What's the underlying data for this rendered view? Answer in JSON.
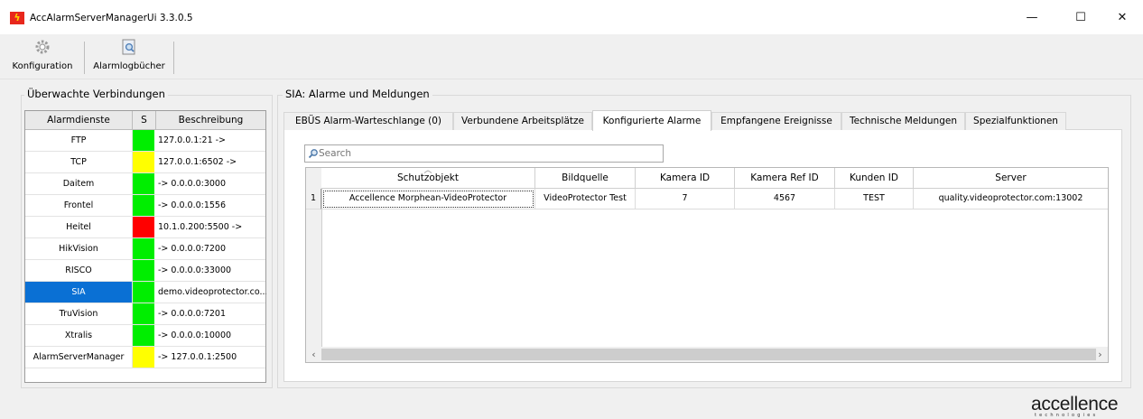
{
  "window": {
    "title": "AccAlarmServerManagerUi 3.3.0.5",
    "app_icon": "app-flash-icon",
    "controls": [
      "minimize-icon",
      "maximize-icon",
      "close-icon"
    ]
  },
  "toolbar": {
    "items": [
      {
        "label": "Konfiguration",
        "icon": "gear-icon"
      },
      {
        "label": "Alarmlogbücher",
        "icon": "logbook-search-icon"
      }
    ]
  },
  "left_panel": {
    "title": "Überwachte Verbindungen",
    "columns": [
      "Alarmdienste",
      "S",
      "Beschreibung"
    ],
    "rows": [
      {
        "name": "FTP",
        "status": "green",
        "description": "127.0.0.1:21 ->"
      },
      {
        "name": "TCP",
        "status": "yellow",
        "description": "127.0.0.1:6502 ->"
      },
      {
        "name": "Daitem",
        "status": "green",
        "description": "-> 0.0.0.0:3000"
      },
      {
        "name": "Frontel",
        "status": "green",
        "description": "-> 0.0.0.0:1556"
      },
      {
        "name": "Heitel",
        "status": "red",
        "description": "10.1.0.200:5500 ->"
      },
      {
        "name": "HikVision",
        "status": "green",
        "description": "-> 0.0.0.0:7200"
      },
      {
        "name": "RISCO",
        "status": "green",
        "description": "-> 0.0.0.0:33000"
      },
      {
        "name": "SIA",
        "status": "green",
        "description": "demo.videoprotector.co...",
        "selected": true
      },
      {
        "name": "TruVision",
        "status": "green",
        "description": "-> 0.0.0.0:7201"
      },
      {
        "name": "Xtralis",
        "status": "green",
        "description": "-> 0.0.0.0:10000"
      },
      {
        "name": "AlarmServerManager",
        "status": "yellow",
        "description": "-> 127.0.0.1:2500"
      }
    ]
  },
  "right_panel": {
    "title": "SIA: Alarme und Meldungen",
    "tabs": [
      {
        "label": "EBÜS Alarm-Warteschlange (0)"
      },
      {
        "label": "Verbundene Arbeitsplätze"
      },
      {
        "label": "Konfigurierte Alarme",
        "active": true
      },
      {
        "label": "Empfangene Ereignisse"
      },
      {
        "label": "Technische Meldungen"
      },
      {
        "label": "Spezialfunktionen"
      }
    ],
    "search": {
      "placeholder": "Search",
      "value": ""
    },
    "grid": {
      "columns": [
        "Schutzobjekt",
        "Bildquelle",
        "Kamera ID",
        "Kamera Ref ID",
        "Kunden ID",
        "Server"
      ],
      "sort_column": "Schutzobjekt",
      "rows": [
        {
          "index": "1",
          "cells": [
            "Accellence Morphean-VideoProtector",
            "VideoProtector Test",
            "7",
            "4567",
            "TEST",
            "quality.videoprotector.com:13002"
          ]
        }
      ]
    }
  },
  "colors": {
    "status_green": "#00ee00",
    "status_yellow": "#ffff00",
    "status_red": "#ff0000",
    "selection": "#0a70d4"
  },
  "logo": {
    "text": "accellence",
    "subtext": "technologies"
  }
}
